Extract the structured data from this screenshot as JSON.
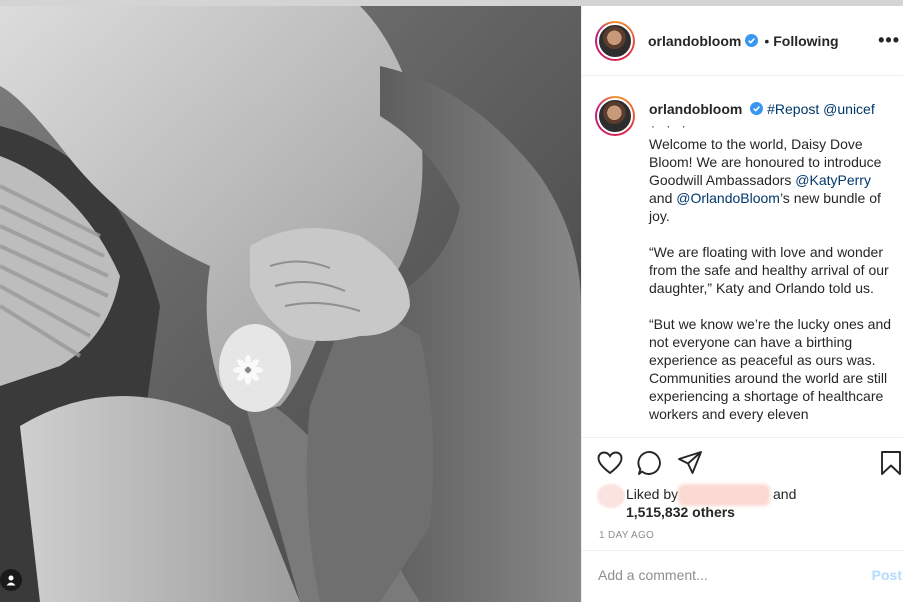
{
  "header": {
    "username": "orlandobloom",
    "separator": "•",
    "follow_status": "Following",
    "more_icon": "more-horizontal-icon"
  },
  "caption": {
    "author": "orlandobloom",
    "repost_tag": "#Repost",
    "repost_mention": "@unicef",
    "dots": "· · ·",
    "p1_before": "Welcome to the world, Daisy Dove Bloom! We are honoured to introduce Goodwill Ambassadors ",
    "p1_mention1": "@KatyPerry",
    "p1_mid": " and ",
    "p1_mention2": "@OrlandoBloom",
    "p1_after": "’s new bundle of joy.",
    "p2": "“We are floating with love and wonder from the safe and healthy arrival of our daughter,” Katy and Orlando told us.",
    "p3": "“But we know we’re the lucky ones and not everyone can have a birthing experience as peaceful as ours was. Communities around the world are still experiencing a shortage of healthcare workers and every eleven"
  },
  "actions": {
    "icons": [
      "heart-icon",
      "comment-icon",
      "share-icon",
      "bookmark-icon"
    ]
  },
  "likes": {
    "liked_by": "Liked by",
    "and": "and",
    "count": "1,515,832 others"
  },
  "timestamp": "1 DAY AGO",
  "comment": {
    "placeholder": "Add a comment...",
    "post_label": "Post"
  },
  "colors": {
    "verified_blue": "#3897f0",
    "link_blue": "#00376b",
    "post_disabled": "#b3dbff",
    "muted_gray": "#8e8e8e"
  }
}
